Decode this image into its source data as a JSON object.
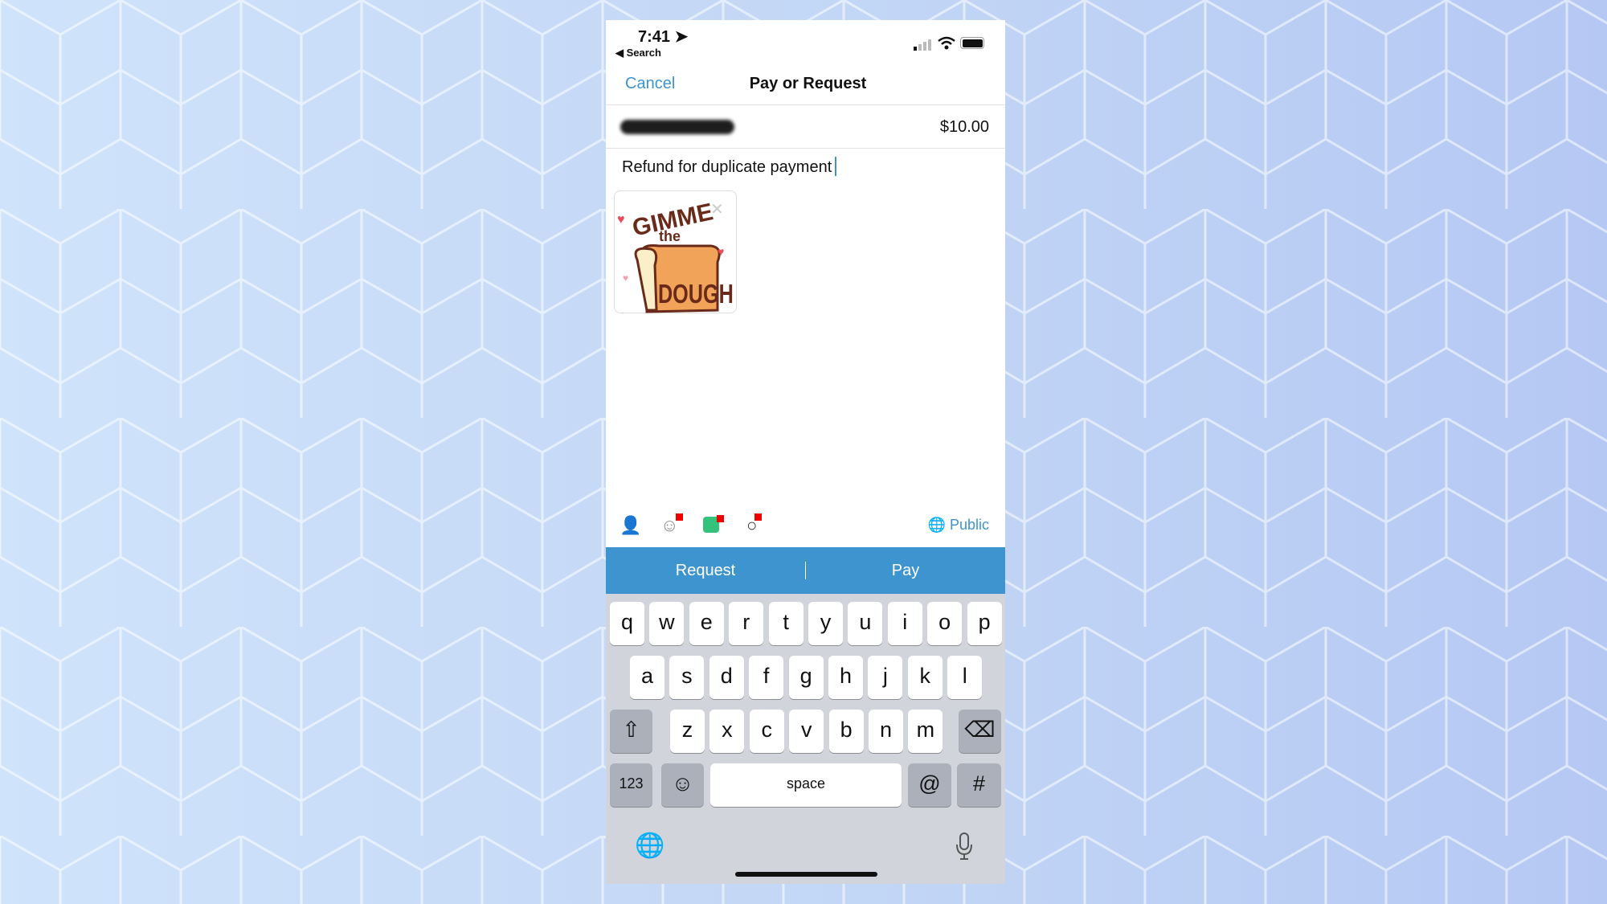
{
  "status_bar": {
    "time": "7:41",
    "back_label": "◀ Search"
  },
  "nav": {
    "cancel": "Cancel",
    "title": "Pay or Request"
  },
  "recipient": {
    "amount": "$10.00"
  },
  "memo": {
    "text": "Refund for duplicate payment"
  },
  "sticker": {
    "text_top": "GIMME",
    "text_mid": "the",
    "text_bottom": "DOUGH"
  },
  "toolbar": {
    "icons": [
      "tag-person-icon",
      "emoji-icon",
      "sticker-icon",
      "gif-icon"
    ],
    "privacy": "Public"
  },
  "actions": {
    "request": "Request",
    "pay": "Pay"
  },
  "keyboard": {
    "row1": [
      "q",
      "w",
      "e",
      "r",
      "t",
      "y",
      "u",
      "i",
      "o",
      "p"
    ],
    "row2": [
      "a",
      "s",
      "d",
      "f",
      "g",
      "h",
      "j",
      "k",
      "l"
    ],
    "row3": [
      "z",
      "x",
      "c",
      "v",
      "b",
      "n",
      "m"
    ],
    "numbers": "123",
    "space": "space",
    "at": "@",
    "hash": "#"
  },
  "colors": {
    "accent": "#3d93d0",
    "action_bar": "#3e94cf"
  }
}
